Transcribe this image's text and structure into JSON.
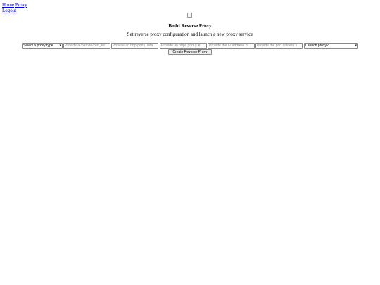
{
  "nav": {
    "home": "Home",
    "proxy": "Proxy",
    "logout": "Logout"
  },
  "header": {
    "title": "Build Reverse Proxy",
    "subtitle": "Set reverse proxy configuration and launch a new proxy service"
  },
  "form": {
    "proxy_type": {
      "selected": "Select a proxy type"
    },
    "cert_key": {
      "placeholder": "Provide a /path/to/cert_ke"
    },
    "http_port": {
      "placeholder": "Provide an http port (Defa"
    },
    "https_port": {
      "placeholder": "Provide an https port (Def"
    },
    "ip_address": {
      "placeholder": "Provide the IP address of"
    },
    "port": {
      "placeholder": "Provide the port caldera s"
    },
    "launch": {
      "selected": "Launch proxy?"
    },
    "submit_label": "Create Reverse Proxy"
  }
}
